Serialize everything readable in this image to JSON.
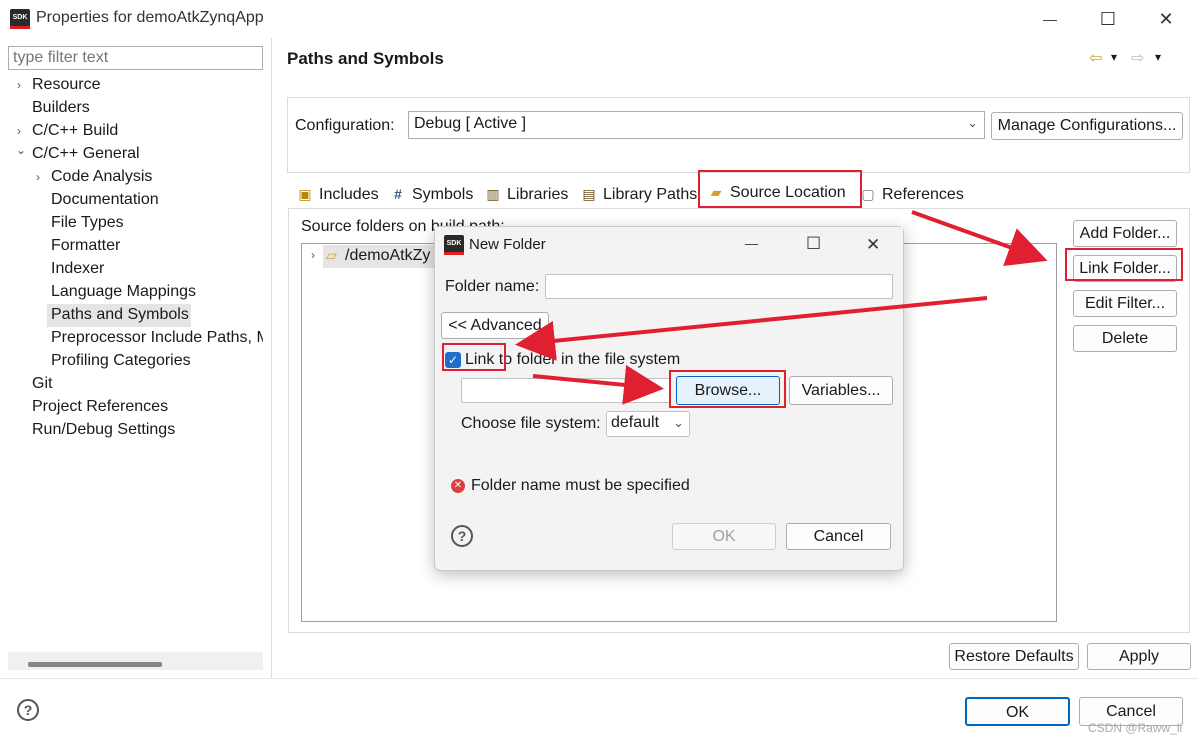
{
  "window": {
    "title": "Properties for demoAtkZynqApp",
    "logo_text": "SDK",
    "minimize": "—",
    "maximize": "☐",
    "close": "✕"
  },
  "left_panel": {
    "filter_placeholder": "type filter text",
    "tree": [
      {
        "label": "Resource",
        "expander": "›"
      },
      {
        "label": "Builders"
      },
      {
        "label": "C/C++ Build",
        "expander": "›"
      },
      {
        "label": "C/C++ General",
        "expander": "⌄"
      },
      {
        "label": "Code Analysis",
        "expander": "›"
      },
      {
        "label": "Documentation"
      },
      {
        "label": "File Types"
      },
      {
        "label": "Formatter"
      },
      {
        "label": "Indexer"
      },
      {
        "label": "Language Mappings"
      },
      {
        "label": "Paths and Symbols",
        "selected": true
      },
      {
        "label": "Preprocessor Include Paths, M"
      },
      {
        "label": "Profiling Categories"
      },
      {
        "label": "Git"
      },
      {
        "label": "Project References"
      },
      {
        "label": "Run/Debug Settings"
      }
    ]
  },
  "main": {
    "page_title": "Paths and Symbols",
    "nav_back": "⇦",
    "nav_forward": "⇨",
    "nav_menu": "▾",
    "configuration": {
      "label": "Configuration:",
      "value": "Debug  [ Active ]",
      "chevron": "⌄",
      "manage_button": "Manage Configurations..."
    },
    "tabs": [
      {
        "label": "Includes",
        "icon": "include-icon"
      },
      {
        "label": "Symbols",
        "icon": "hash-icon"
      },
      {
        "label": "Libraries",
        "icon": "library-icon"
      },
      {
        "label": "Library Paths",
        "icon": "library-path-icon"
      },
      {
        "label": "Source Location",
        "icon": "source-folder-icon",
        "active": true
      },
      {
        "label": "References",
        "icon": "reference-icon"
      }
    ],
    "source_label": "Source folders on build path:",
    "source_tree": [
      {
        "label": "/demoAtkZy",
        "expander": "›"
      }
    ],
    "side_buttons": {
      "add_folder": "Add Folder...",
      "link_folder": "Link Folder...",
      "edit_filter": "Edit Filter...",
      "delete": "Delete"
    },
    "restore_defaults": "Restore Defaults",
    "apply": "Apply"
  },
  "footer": {
    "help": "?",
    "ok": "OK",
    "cancel": "Cancel"
  },
  "dialog": {
    "title": "New Folder",
    "logo_text": "SDK",
    "minimize": "—",
    "maximize": "☐",
    "close": "✕",
    "folder_name_label": "Folder name:",
    "folder_name_value": "",
    "advanced_button": "<< Advanced",
    "link_checkbox_label": "Link to folder in the file system",
    "link_checked": true,
    "link_path_value": "",
    "browse_button": "Browse...",
    "variables_button": "Variables...",
    "file_system_label": "Choose file system:",
    "file_system_value": "default",
    "error_message": "Folder name must be specified",
    "help": "?",
    "ok_button": "OK",
    "cancel_button": "Cancel"
  },
  "watermark": "CSDN @Raww_li",
  "colors": {
    "annotation_red": "#e02030",
    "selection_gray": "#e5e5e5",
    "checkbox_blue": "#1e6fc8",
    "default_button_border": "#0067c0"
  }
}
